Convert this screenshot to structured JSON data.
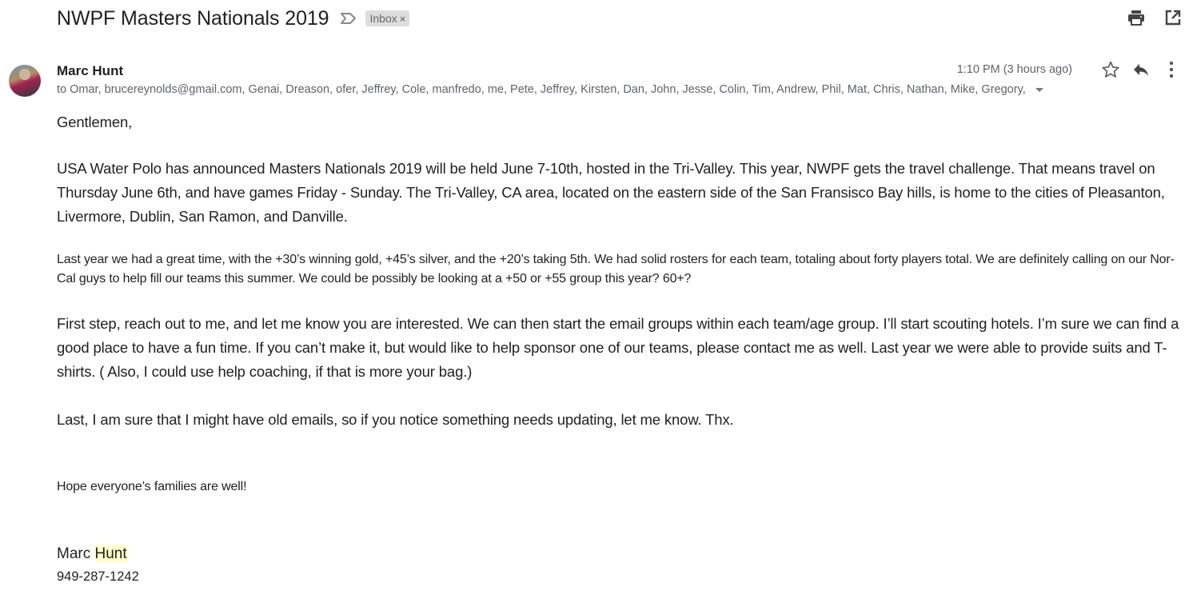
{
  "email": {
    "subject": "NWPF Masters Nationals 2019",
    "labels": [
      {
        "name": "Inbox",
        "remove": "×"
      }
    ],
    "sender_name": "Marc Hunt",
    "recipients": "to Omar, brucereynolds@gmail.com, Genai, Dreason, ofer, Jeffrey, Cole, manfredo, me, Pete, Jeffrey, Kirsten, Dan, John, Jesse, Colin, Tim, Andrew, Phil, Mat, Chris, Nathan, Mike, Gregory,",
    "timestamp": "1:10 PM (3 hours ago)",
    "body": {
      "greeting": "Gentlemen,",
      "paragraphs": [
        "USA Water Polo has announced  Masters Nationals 2019 will be held June 7-10th, hosted in the Tri-Valley.   This year, NWPF gets the travel challenge. That means travel on Thursday June 6th, and have games Friday - Sunday. The Tri-Valley, CA area, located on the eastern side of the San Fransisco Bay hills, is home to the cities of Pleasanton, Livermore, Dublin, San Ramon, and Danville.",
        "Last year we had a great time, with the +30’s winning gold, +45’s silver, and the +20’s taking 5th.  We had solid rosters for each team, totaling about forty players total.   We are definitely calling on our Nor-Cal guys to help fill our teams this summer.  We could be possibly be looking at a +50 or +55 group this year? 60+?",
        "First step, reach out to me, and let me know you are interested.  We can then start the email groups within each team/age group. I’ll start scouting hotels. I’m sure we can find a good place to have a fun time. If you can’t make it, but would like to help sponsor one of our teams, please contact me as well. Last year we were able to provide suits and T-shirts.  ( Also, I could use help coaching, if that is more your bag.)",
        "Last, I am sure that I might have old emails, so if you notice something needs updating, let me know. Thx.",
        "Hope everyone’s families are well!"
      ],
      "signature": {
        "first": "Marc ",
        "last_highlighted": "Hunt",
        "phone": "949-287-1242"
      }
    }
  },
  "icons": {
    "importance": "importance-marker-icon",
    "print": "print-icon",
    "open_new_window": "open-in-new-window-icon",
    "star": "star-icon",
    "reply": "reply-icon",
    "more": "more-vert-icon",
    "recipients_expand": "chevron-down-icon"
  },
  "colors": {
    "highlight": "#ffffc8",
    "label_chip_bg": "#dddddd",
    "meta_text": "#5f6368"
  }
}
